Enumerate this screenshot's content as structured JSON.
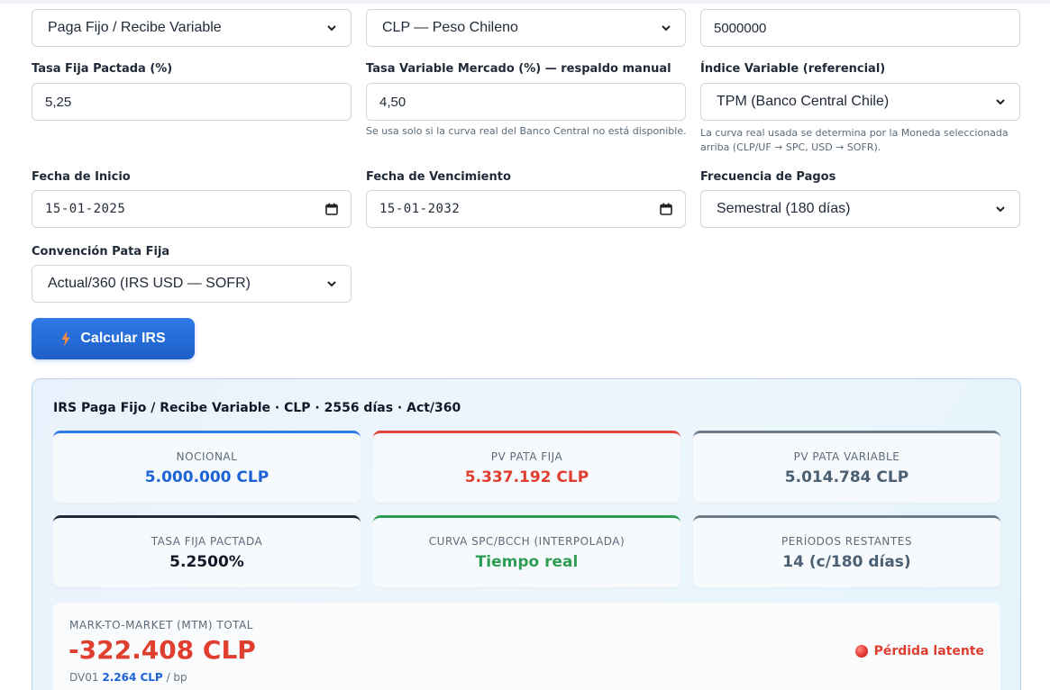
{
  "form": {
    "direction": {
      "value": "Paga Fijo / Recibe Variable"
    },
    "currency": {
      "value": "CLP — Peso Chileno"
    },
    "notional": {
      "value": "5000000"
    },
    "fixed_rate": {
      "label": "Tasa Fija Pactada (%)",
      "value": "5,25"
    },
    "float_rate": {
      "label": "Tasa Variable Mercado (%) — respaldo manual",
      "value": "4,50",
      "help": "Se usa solo si la curva real del Banco Central no está disponible."
    },
    "index": {
      "label": "Índice Variable (referencial)",
      "value": "TPM (Banco Central Chile)",
      "help_line1": "La curva real usada se determina por la Moneda seleccionada",
      "help_line2": "arriba (CLP/UF → SPC, USD → SOFR)."
    },
    "start_date": {
      "label": "Fecha de Inicio",
      "value": "15-01-2025"
    },
    "end_date": {
      "label": "Fecha de Vencimiento",
      "value": "15-01-2032"
    },
    "frequency": {
      "label": "Frecuencia de Pagos",
      "value": "Semestral (180 días)"
    },
    "convention": {
      "label": "Convención Pata Fija",
      "value": "Actual/360 (IRS USD — SOFR)"
    }
  },
  "calc_button": {
    "label": "Calcular IRS",
    "icon": "lightning-icon"
  },
  "results": {
    "title": "IRS Paga Fijo / Recibe Variable · CLP · 2556 días · Act/360",
    "cards": [
      {
        "label": "NOCIONAL",
        "value": "5.000.000 CLP",
        "accent": "#2f7ae6",
        "color": "#1d63d6"
      },
      {
        "label": "PV PATA FIJA",
        "value": "5.337.192 CLP",
        "accent": "#e0443a",
        "color": "#e03e2f"
      },
      {
        "label": "PV PATA VARIABLE",
        "value": "5.014.784 CLP",
        "accent": "#6b7b8a",
        "color": "#4b6072"
      },
      {
        "label": "TASA FIJA PACTADA",
        "value": "5.2500%",
        "accent": "#1f2937",
        "color": "#111827"
      },
      {
        "label": "CURVA SPC/BCCH (INTERPOLADA)",
        "value": "Tiempo real",
        "accent": "#2f9e55",
        "color": "#2f9e55"
      },
      {
        "label": "PERÍODOS RESTANTES",
        "value": "14 (c/180 días)",
        "accent": "#6b7b8a",
        "color": "#4b6072"
      }
    ],
    "mtm": {
      "label": "MARK-TO-MARKET (MTM) TOTAL",
      "value": "-322.408 CLP",
      "dv01_prefix": "DV01",
      "dv01_value": "2.264 CLP",
      "dv01_suffix": "/ bp",
      "status": "Pérdida latente",
      "status_icon": "red-circle-icon"
    }
  }
}
